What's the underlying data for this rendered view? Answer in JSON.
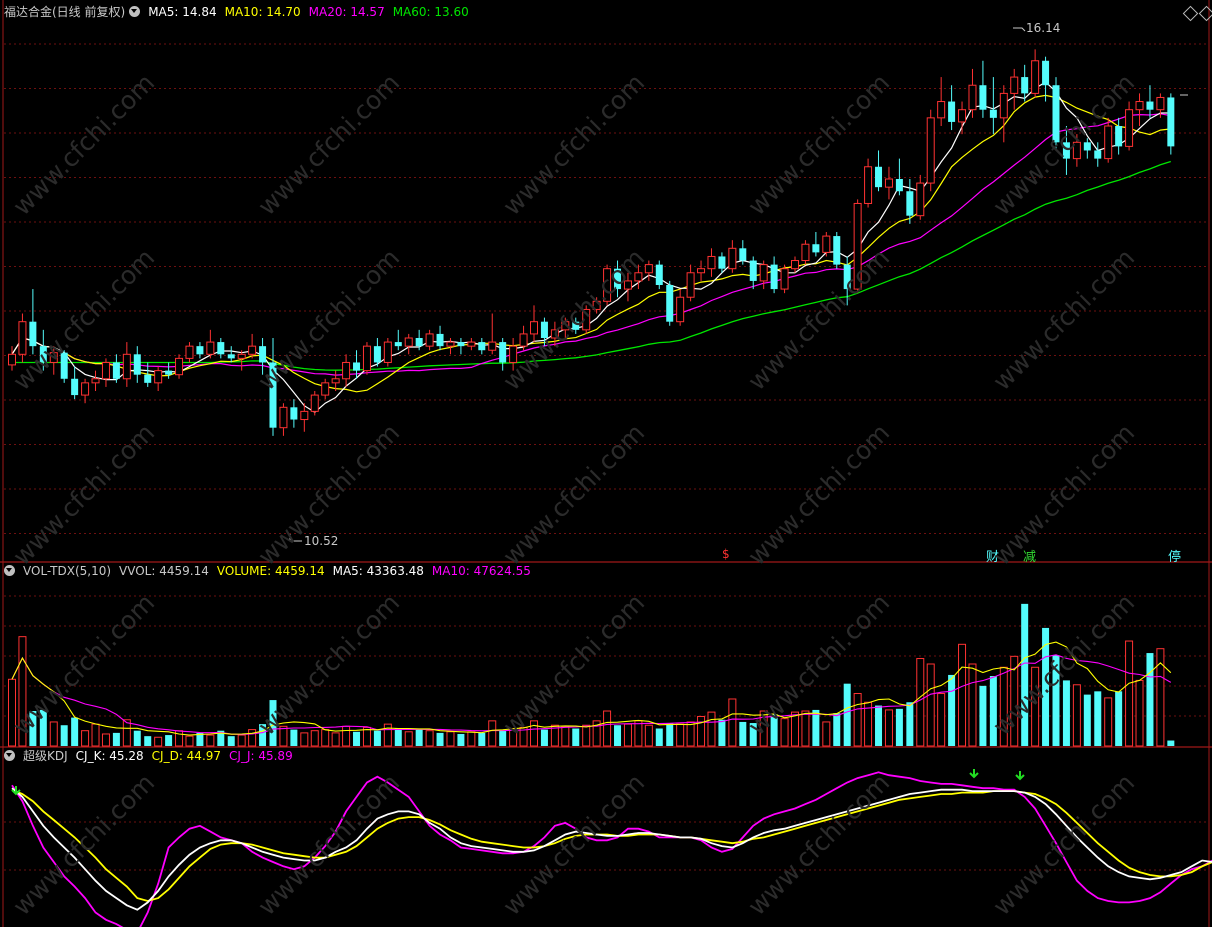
{
  "stock": {
    "title": "福达合金(日线 前复权)",
    "ma5_label": "MA5: 14.84",
    "ma10_label": "MA10: 14.70",
    "ma20_label": "MA20: 14.57",
    "ma60_label": "MA60: 13.60",
    "high_label": "16.14",
    "low_label": "10.52"
  },
  "event_markers": {
    "s": "$",
    "cai": "财",
    "jian": "减",
    "ting": "停"
  },
  "volume_panel": {
    "indicator": "VOL-TDX(5,10)",
    "vvol": "VVOL: 4459.14",
    "volume": "VOLUME: 4459.14",
    "ma5": "MA5: 43363.48",
    "ma10": "MA10: 47624.55"
  },
  "kdj_panel": {
    "indicator": "超级KDJ",
    "k": "CJ_K: 45.28",
    "d": "CJ_D: 44.97",
    "j": "CJ_J: 45.89"
  },
  "watermark": "www.cfchi.com",
  "colors": {
    "up": "#ff3232",
    "down": "#54fcfc",
    "ma5": "#ffffff",
    "ma10": "#ffff00",
    "ma20": "#ff00ff",
    "ma60": "#00e600",
    "grid": "#6e1010",
    "border": "#a01818"
  },
  "chart_data": {
    "type": "candlestick",
    "price_axis_range": [
      10.0,
      16.5
    ],
    "volume_axis_range": [
      0,
      150000
    ],
    "kdj_axis_range": [
      0,
      110
    ],
    "candles": [
      [
        12.27,
        12.5,
        12.2,
        12.4
      ],
      [
        12.4,
        12.9,
        12.3,
        12.8
      ],
      [
        12.8,
        13.2,
        12.4,
        12.5
      ],
      [
        12.5,
        12.7,
        12.2,
        12.3
      ],
      [
        12.3,
        12.5,
        12.15,
        12.42
      ],
      [
        12.42,
        12.45,
        12.05,
        12.1
      ],
      [
        12.1,
        12.25,
        11.85,
        11.9
      ],
      [
        11.9,
        12.1,
        11.8,
        12.05
      ],
      [
        12.05,
        12.2,
        11.95,
        12.1
      ],
      [
        12.1,
        12.35,
        12.0,
        12.3
      ],
      [
        12.3,
        12.4,
        12.05,
        12.1
      ],
      [
        12.1,
        12.55,
        12.0,
        12.4
      ],
      [
        12.4,
        12.5,
        12.05,
        12.15
      ],
      [
        12.15,
        12.3,
        12.0,
        12.05
      ],
      [
        12.05,
        12.25,
        11.95,
        12.2
      ],
      [
        12.2,
        12.3,
        12.1,
        12.15
      ],
      [
        12.15,
        12.4,
        12.1,
        12.35
      ],
      [
        12.35,
        12.55,
        12.3,
        12.5
      ],
      [
        12.5,
        12.55,
        12.35,
        12.4
      ],
      [
        12.4,
        12.7,
        12.35,
        12.55
      ],
      [
        12.55,
        12.6,
        12.35,
        12.4
      ],
      [
        12.4,
        12.5,
        12.3,
        12.35
      ],
      [
        12.35,
        12.45,
        12.2,
        12.4
      ],
      [
        12.4,
        12.65,
        12.35,
        12.5
      ],
      [
        12.5,
        12.6,
        12.15,
        12.3
      ],
      [
        12.3,
        12.6,
        11.4,
        11.5
      ],
      [
        11.5,
        11.8,
        11.4,
        11.75
      ],
      [
        11.75,
        11.85,
        11.5,
        11.6
      ],
      [
        11.6,
        11.8,
        11.45,
        11.7
      ],
      [
        11.7,
        11.95,
        11.65,
        11.9
      ],
      [
        11.9,
        12.1,
        11.85,
        12.05
      ],
      [
        12.05,
        12.2,
        11.95,
        12.1
      ],
      [
        12.1,
        12.4,
        12.0,
        12.3
      ],
      [
        12.3,
        12.45,
        12.1,
        12.2
      ],
      [
        12.2,
        12.55,
        12.15,
        12.5
      ],
      [
        12.5,
        12.6,
        12.25,
        12.3
      ],
      [
        12.3,
        12.6,
        12.25,
        12.55
      ],
      [
        12.55,
        12.7,
        12.45,
        12.5
      ],
      [
        12.5,
        12.65,
        12.4,
        12.6
      ],
      [
        12.6,
        12.7,
        12.45,
        12.5
      ],
      [
        12.5,
        12.7,
        12.45,
        12.65
      ],
      [
        12.65,
        12.75,
        12.45,
        12.5
      ],
      [
        12.5,
        12.6,
        12.4,
        12.55
      ],
      [
        12.55,
        12.6,
        12.4,
        12.5
      ],
      [
        12.5,
        12.6,
        12.45,
        12.55
      ],
      [
        12.55,
        12.6,
        12.4,
        12.45
      ],
      [
        12.45,
        12.9,
        12.4,
        12.55
      ],
      [
        12.55,
        12.6,
        12.2,
        12.3
      ],
      [
        12.3,
        12.6,
        12.2,
        12.5
      ],
      [
        12.5,
        12.75,
        12.45,
        12.65
      ],
      [
        12.65,
        13.0,
        12.55,
        12.8
      ],
      [
        12.8,
        12.85,
        12.5,
        12.6
      ],
      [
        12.6,
        12.8,
        12.5,
        12.7
      ],
      [
        12.7,
        12.85,
        12.6,
        12.8
      ],
      [
        12.8,
        12.85,
        12.65,
        12.7
      ],
      [
        12.7,
        13.0,
        12.65,
        12.95
      ],
      [
        12.95,
        13.1,
        12.9,
        13.05
      ],
      [
        13.05,
        13.5,
        13.0,
        13.45
      ],
      [
        13.45,
        13.55,
        13.1,
        13.2
      ],
      [
        13.2,
        13.4,
        13.05,
        13.3
      ],
      [
        13.3,
        13.5,
        13.2,
        13.4
      ],
      [
        13.4,
        13.55,
        13.3,
        13.5
      ],
      [
        13.5,
        13.55,
        13.2,
        13.25
      ],
      [
        13.25,
        13.3,
        12.75,
        12.8
      ],
      [
        12.8,
        13.2,
        12.75,
        13.1
      ],
      [
        13.1,
        13.5,
        13.05,
        13.4
      ],
      [
        13.4,
        13.55,
        13.3,
        13.45
      ],
      [
        13.45,
        13.7,
        13.35,
        13.6
      ],
      [
        13.6,
        13.65,
        13.4,
        13.45
      ],
      [
        13.45,
        13.8,
        13.4,
        13.7
      ],
      [
        13.7,
        13.8,
        13.5,
        13.55
      ],
      [
        13.55,
        13.6,
        13.2,
        13.3
      ],
      [
        13.3,
        13.55,
        13.2,
        13.5
      ],
      [
        13.5,
        13.6,
        13.15,
        13.2
      ],
      [
        13.2,
        13.5,
        13.15,
        13.45
      ],
      [
        13.45,
        13.6,
        13.4,
        13.55
      ],
      [
        13.55,
        13.8,
        13.5,
        13.75
      ],
      [
        13.75,
        13.9,
        13.6,
        13.65
      ],
      [
        13.65,
        13.9,
        13.6,
        13.85
      ],
      [
        13.85,
        13.9,
        13.45,
        13.5
      ],
      [
        13.5,
        13.6,
        13.0,
        13.2
      ],
      [
        13.2,
        14.3,
        13.15,
        14.25
      ],
      [
        14.25,
        14.8,
        14.2,
        14.7
      ],
      [
        14.7,
        14.9,
        14.4,
        14.45
      ],
      [
        14.45,
        14.7,
        14.3,
        14.55
      ],
      [
        14.55,
        14.8,
        14.35,
        14.4
      ],
      [
        14.4,
        14.55,
        14.0,
        14.1
      ],
      [
        14.1,
        14.6,
        14.05,
        14.5
      ],
      [
        14.5,
        15.4,
        14.4,
        15.3
      ],
      [
        15.3,
        15.8,
        15.2,
        15.5
      ],
      [
        15.5,
        15.7,
        15.15,
        15.25
      ],
      [
        15.25,
        15.5,
        15.1,
        15.4
      ],
      [
        15.4,
        15.9,
        15.3,
        15.7
      ],
      [
        15.7,
        16.0,
        15.3,
        15.4
      ],
      [
        15.4,
        15.8,
        15.1,
        15.3
      ],
      [
        15.3,
        15.7,
        15.0,
        15.6
      ],
      [
        15.6,
        15.9,
        15.4,
        15.8
      ],
      [
        15.8,
        15.95,
        15.5,
        15.6
      ],
      [
        15.6,
        16.14,
        15.55,
        16.0
      ],
      [
        16.0,
        16.05,
        15.5,
        15.7
      ],
      [
        15.7,
        15.8,
        14.9,
        15.0
      ],
      [
        15.0,
        15.2,
        14.6,
        14.8
      ],
      [
        14.8,
        15.1,
        14.7,
        15.0
      ],
      [
        15.0,
        15.05,
        14.8,
        14.9
      ],
      [
        14.9,
        15.0,
        14.7,
        14.8
      ],
      [
        14.8,
        15.3,
        14.75,
        15.2
      ],
      [
        15.2,
        15.3,
        14.85,
        14.95
      ],
      [
        14.95,
        15.5,
        14.9,
        15.4
      ],
      [
        15.4,
        15.6,
        15.2,
        15.5
      ],
      [
        15.5,
        15.7,
        15.3,
        15.4
      ],
      [
        15.4,
        15.6,
        15.3,
        15.55
      ],
      [
        15.55,
        15.6,
        14.85,
        14.95
      ]
    ],
    "volumes": [
      61000,
      100000,
      32000,
      33000,
      22000,
      19000,
      26000,
      14000,
      20000,
      11000,
      12000,
      24000,
      14000,
      9000,
      8000,
      10000,
      14000,
      9000,
      12000,
      10000,
      14000,
      9000,
      10000,
      15000,
      20000,
      42000,
      18000,
      15000,
      12000,
      14000,
      15000,
      12000,
      18000,
      13000,
      17000,
      14000,
      20000,
      16000,
      13000,
      15000,
      14000,
      12000,
      13000,
      11000,
      13000,
      12000,
      23000,
      15000,
      16000,
      17000,
      23000,
      15000,
      19000,
      18000,
      16000,
      19000,
      23000,
      32000,
      19000,
      20000,
      23000,
      19000,
      16000,
      21000,
      20000,
      22000,
      27000,
      31000,
      24000,
      43000,
      22000,
      21000,
      32000,
      29000,
      25000,
      31000,
      32000,
      33000,
      22000,
      30000,
      57000,
      48000,
      40000,
      37000,
      33000,
      34000,
      40000,
      80000,
      75000,
      48000,
      65000,
      93000,
      75000,
      55000,
      64000,
      72000,
      82000,
      130000,
      72000,
      108000,
      83000,
      60000,
      56000,
      47000,
      50000,
      44000,
      50000,
      96000,
      60000,
      85000,
      89000,
      5000
    ],
    "series": [
      {
        "name": "MA5",
        "last": 14.84
      },
      {
        "name": "MA10",
        "last": 14.7
      },
      {
        "name": "MA20",
        "last": 14.57
      },
      {
        "name": "MA60",
        "last": 13.6
      },
      {
        "name": "CJ_K",
        "last": 45.28
      },
      {
        "name": "CJ_D",
        "last": 44.97
      },
      {
        "name": "CJ_J",
        "last": 45.89
      }
    ],
    "kdj_k": [
      96,
      90,
      80,
      70,
      62,
      55,
      48,
      40,
      32,
      25,
      20,
      15,
      12,
      17,
      25,
      35,
      43,
      50,
      55,
      58,
      60,
      60,
      58,
      55,
      52,
      50,
      48,
      47,
      46,
      46,
      48,
      52,
      55,
      60,
      68,
      75,
      78,
      80,
      80,
      78,
      72,
      68,
      62,
      58,
      56,
      55,
      54,
      53,
      52,
      52,
      53,
      56,
      60,
      64,
      66,
      65,
      64,
      63,
      63,
      64,
      65,
      65,
      64,
      63,
      62,
      62,
      61,
      58,
      56,
      55,
      58,
      62,
      65,
      67,
      68,
      70,
      72,
      74,
      76,
      78,
      80,
      82,
      84,
      86,
      88,
      90,
      92,
      93,
      94,
      95,
      95,
      95,
      94,
      94,
      94,
      94,
      94,
      93,
      90,
      85,
      78,
      70,
      62,
      55,
      48,
      42,
      38,
      35,
      34,
      33,
      34,
      36,
      38,
      42,
      46,
      45
    ],
    "kdj_d": [
      95,
      92,
      87,
      80,
      74,
      68,
      62,
      55,
      48,
      40,
      34,
      28,
      20,
      18,
      20,
      26,
      34,
      42,
      48,
      54,
      57,
      58,
      58,
      57,
      55,
      53,
      51,
      50,
      49,
      48,
      48,
      50,
      52,
      56,
      62,
      68,
      72,
      75,
      76,
      76,
      74,
      71,
      67,
      64,
      61,
      59,
      58,
      57,
      56,
      55,
      55,
      56,
      58,
      61,
      63,
      64,
      64,
      64,
      63,
      63,
      64,
      64,
      64,
      63,
      62,
      62,
      61,
      60,
      59,
      58,
      59,
      61,
      62,
      64,
      66,
      68,
      70,
      72,
      74,
      76,
      78,
      80,
      82,
      84,
      86,
      88,
      89,
      90,
      91,
      92,
      92,
      93,
      93,
      93,
      94,
      94,
      94,
      93,
      92,
      89,
      85,
      79,
      72,
      65,
      58,
      52,
      46,
      41,
      38,
      36,
      35,
      35,
      36,
      38,
      42,
      45
    ],
    "kdj_j": [
      98,
      87,
      70,
      55,
      45,
      35,
      28,
      20,
      10,
      5,
      2,
      -2,
      -4,
      10,
      30,
      55,
      62,
      68,
      70,
      66,
      62,
      60,
      58,
      52,
      48,
      45,
      42,
      40,
      42,
      48,
      56,
      66,
      80,
      90,
      100,
      104,
      100,
      95,
      90,
      80,
      70,
      64,
      60,
      55,
      54,
      53,
      52,
      51,
      51,
      52,
      56,
      62,
      70,
      72,
      68,
      62,
      60,
      60,
      62,
      68,
      68,
      66,
      62,
      62,
      62,
      62,
      60,
      55,
      52,
      54,
      62,
      70,
      75,
      78,
      80,
      82,
      85,
      88,
      92,
      96,
      100,
      103,
      105,
      107,
      105,
      104,
      103,
      101,
      100,
      99,
      99,
      98,
      97,
      96,
      96,
      95,
      95,
      90,
      82,
      70,
      58,
      45,
      32,
      25,
      20,
      18,
      17,
      17,
      18,
      20,
      24,
      30,
      36,
      40,
      42,
      46
    ]
  }
}
